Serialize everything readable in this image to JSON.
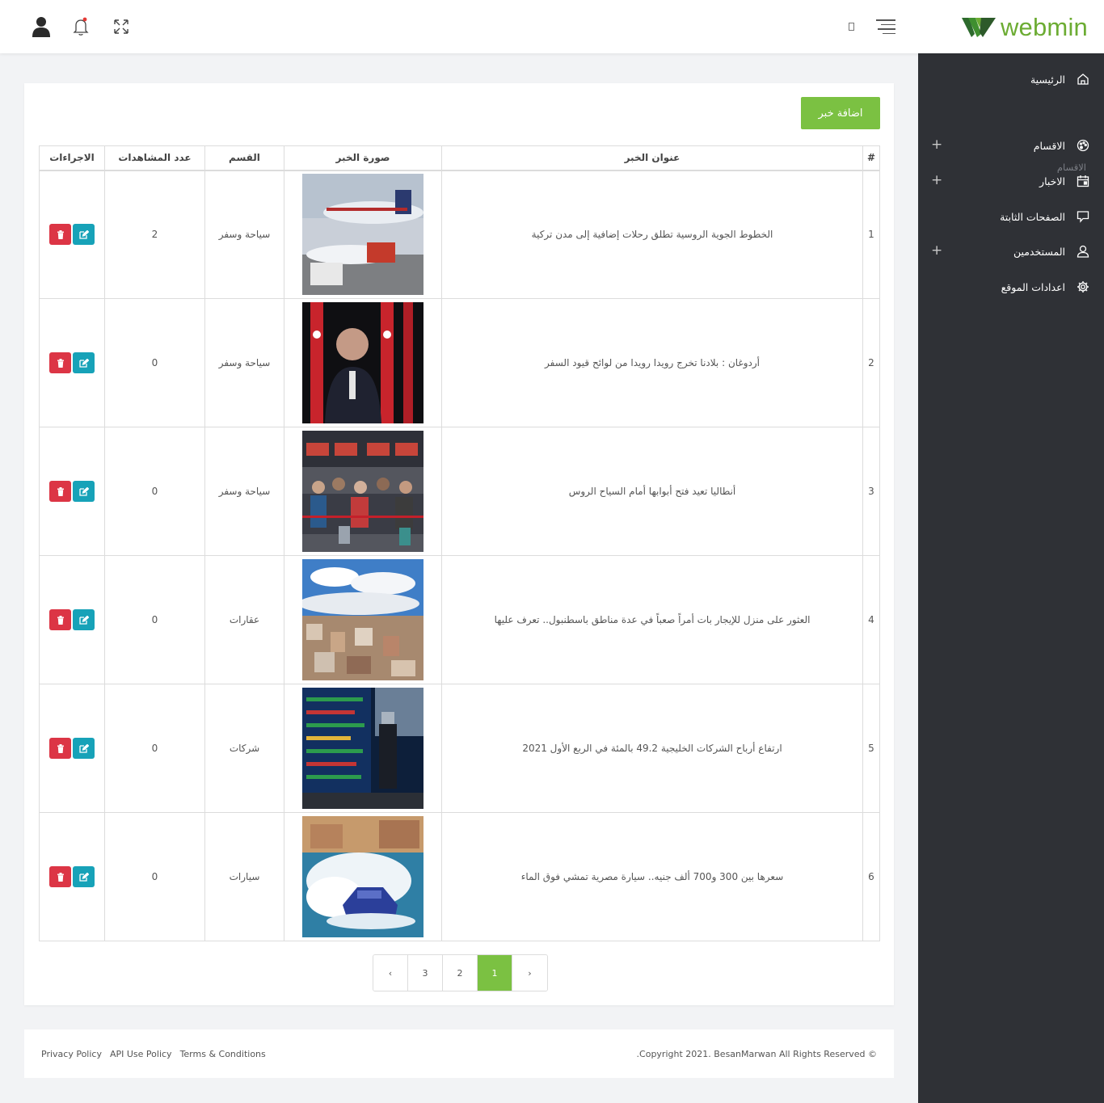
{
  "header": {
    "logo_text": "webmin",
    "brand_color": "#6cac33"
  },
  "sidebar": {
    "items": [
      {
        "label": "الرئيسية",
        "icon": "home-icon",
        "expandable": false
      },
      {
        "label": "الاقسام",
        "icon": "palette-icon",
        "expandable": true
      },
      {
        "label": "الاخبار",
        "icon": "calendar-icon",
        "expandable": true
      },
      {
        "label": "الصفحات الثابتة",
        "icon": "chat-icon",
        "expandable": false
      },
      {
        "label": "المستخدمين",
        "icon": "user-icon",
        "expandable": true
      },
      {
        "label": "اعدادات الموقع",
        "icon": "gear-icon",
        "expandable": false
      }
    ],
    "section_label": "الاقسام",
    "plus": "+"
  },
  "main": {
    "add_button": "اضافة خبر",
    "accent_color": "#7bc142",
    "table": {
      "headers": {
        "num": "#",
        "title": "عنوان الخبر",
        "image": "صورة الخبر",
        "category": "القسم",
        "views": "عدد المشاهدات",
        "actions": "الاجراءات"
      },
      "rows": [
        {
          "num": "1",
          "title": "الخطوط الجوية الروسية تطلق رحلات إضافية إلى مدن تركية",
          "category": "سياحة وسفر",
          "views": "2"
        },
        {
          "num": "2",
          "title": "أردوغان : بلادنا تخرج رويدا رويدا من لوائح قيود السفر",
          "category": "سياحة وسفر",
          "views": "0"
        },
        {
          "num": "3",
          "title": "أنطاليا تعيد فتح أبوابها أمام السياح الروس",
          "category": "سياحة وسفر",
          "views": "0"
        },
        {
          "num": "4",
          "title": "العثور على منزل للإيجار بات أمراً صعباً في عدة مناطق باسطنبول.. تعرف عليها",
          "category": "عقارات",
          "views": "0"
        },
        {
          "num": "5",
          "title": "ارتفاع أرباح الشركات الخليجية 49.2 بالمئة في الربع الأول 2021",
          "category": "شركات",
          "views": "0"
        },
        {
          "num": "6",
          "title": "سعرها بين 300 و700 ألف جنيه.. سيارة مصرية تمشي فوق الماء",
          "category": "سيارات",
          "views": "0"
        }
      ]
    },
    "pagination": {
      "prev": "‹",
      "pages": [
        "3",
        "2",
        "1"
      ],
      "active": "1",
      "next": "›"
    }
  },
  "footer": {
    "links": [
      "Privacy Policy",
      "API Use Policy",
      "Terms & Conditions"
    ],
    "copyright": ".Copyright 2021. BesanMarwan All Rights Reserved ©"
  }
}
